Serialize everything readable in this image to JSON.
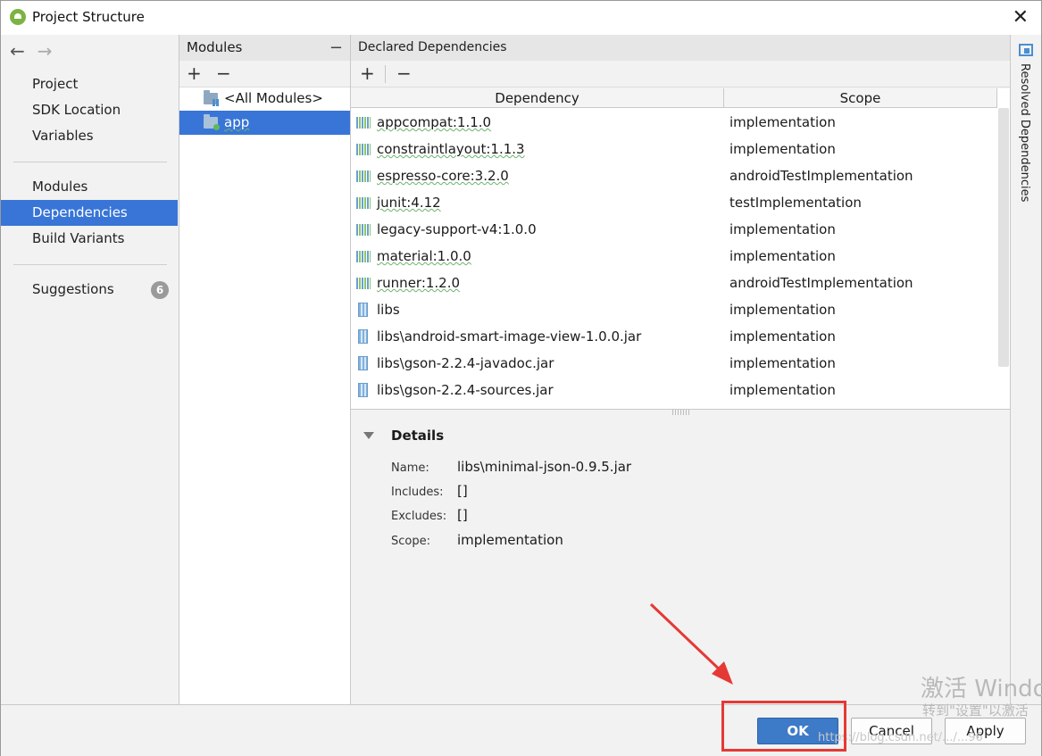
{
  "window": {
    "title": "Project Structure",
    "close_glyph": "✕"
  },
  "nav": {
    "back": "←",
    "forward": "→",
    "items": [
      {
        "label": "Project"
      },
      {
        "label": "SDK Location"
      },
      {
        "label": "Variables"
      },
      {
        "label": "Modules"
      },
      {
        "label": "Dependencies",
        "selected": true
      },
      {
        "label": "Build Variants"
      },
      {
        "label": "Suggestions",
        "badge": "6"
      }
    ]
  },
  "modules": {
    "header": "Modules",
    "minus": "−",
    "add": "+",
    "remove": "−",
    "items": [
      {
        "label": "<All Modules>"
      },
      {
        "label": "app",
        "selected": true
      }
    ]
  },
  "declared": {
    "header": "Declared Dependencies",
    "add": "+",
    "remove": "−",
    "columns": {
      "dependency": "Dependency",
      "scope": "Scope"
    },
    "rows": [
      {
        "dependency": "appcompat:1.1.0",
        "scope": "implementation",
        "icon": "library-icon"
      },
      {
        "dependency": "constraintlayout:1.1.3",
        "scope": "implementation",
        "icon": "library-icon"
      },
      {
        "dependency": "espresso-core:3.2.0",
        "scope": "androidTestImplementation",
        "icon": "library-icon"
      },
      {
        "dependency": "junit:4.12",
        "scope": "testImplementation",
        "icon": "library-icon"
      },
      {
        "dependency": "legacy-support-v4:1.0.0",
        "scope": "implementation",
        "icon": "library-icon"
      },
      {
        "dependency": "material:1.0.0",
        "scope": "implementation",
        "icon": "library-icon"
      },
      {
        "dependency": "runner:1.2.0",
        "scope": "androidTestImplementation",
        "icon": "library-icon"
      },
      {
        "dependency": "libs",
        "scope": "implementation",
        "icon": "jar-icon"
      },
      {
        "dependency": "libs\\android-smart-image-view-1.0.0.jar",
        "scope": "implementation",
        "icon": "jar-icon"
      },
      {
        "dependency": "libs\\gson-2.2.4-javadoc.jar",
        "scope": "implementation",
        "icon": "jar-icon"
      },
      {
        "dependency": "libs\\gson-2.2.4-sources.jar",
        "scope": "implementation",
        "icon": "jar-icon"
      }
    ]
  },
  "details": {
    "title": "Details",
    "fields": [
      {
        "label": "Name:",
        "value": "libs\\minimal-json-0.9.5.jar"
      },
      {
        "label": "Includes:",
        "value": "[]"
      },
      {
        "label": "Excludes:",
        "value": "[]"
      },
      {
        "label": "Scope:",
        "value": "implementation"
      }
    ]
  },
  "side_panel": {
    "label": "Resolved Dependencies"
  },
  "buttons": {
    "ok": "OK",
    "cancel": "Cancel",
    "apply": "Apply"
  },
  "watermark": {
    "line1": "激活 Windo",
    "line2": "转到\"设置\"以激活",
    "line3": "https://blog.csdn.net/.../...96"
  },
  "colors": {
    "selection": "#3875d7",
    "annotation": "#e53935",
    "ok_button": "#3d7ac8"
  }
}
